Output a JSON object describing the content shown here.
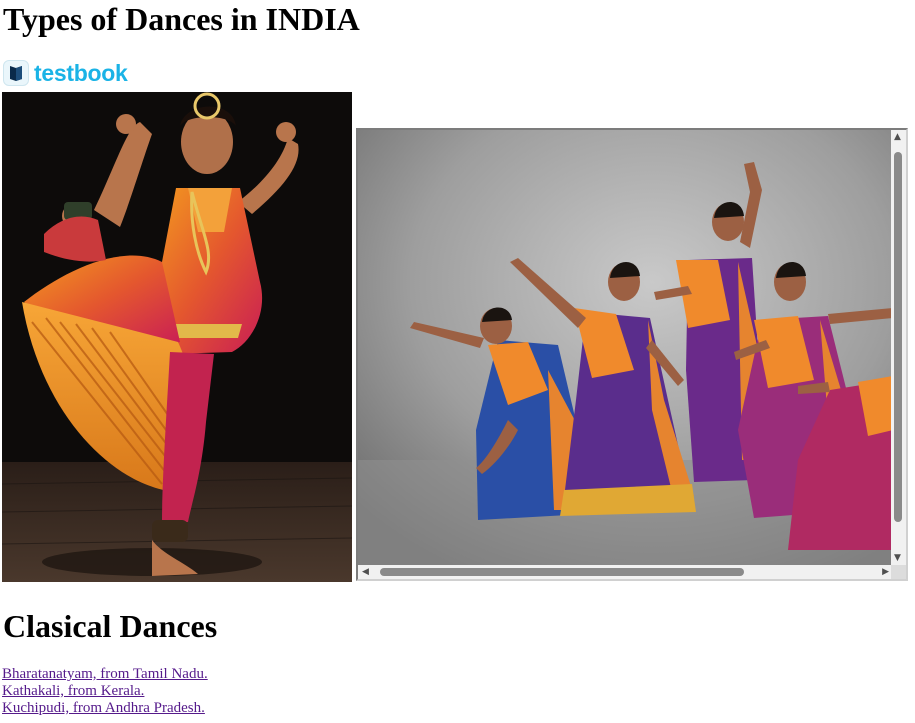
{
  "title": "Types of Dances in INDIA",
  "logo": {
    "text": "testbook",
    "color": "#1ab3e6",
    "icon": "testbook-logo-icon"
  },
  "images": {
    "left": {
      "icon": "bharatanatyam-solo-dancer-photo"
    },
    "right": {
      "icon": "group-of-dancers-photo"
    }
  },
  "section_heading": "Clasical Dances",
  "dances": [
    "Bharatanatyam, from Tamil Nadu.",
    "Kathakali, from Kerala.",
    "Kuchipudi, from Andhra Pradesh."
  ],
  "colors": {
    "visited_link": "#551a8b",
    "logo_accent": "#1ab3e6"
  }
}
